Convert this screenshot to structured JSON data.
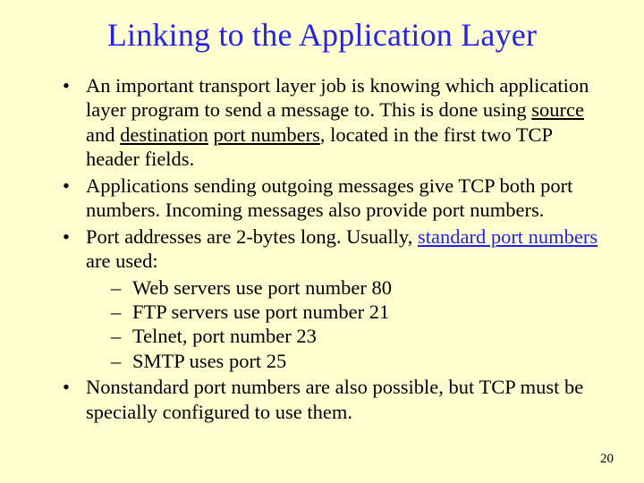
{
  "title": "Linking to the Application Layer",
  "pagenum": "20",
  "b1": {
    "pre": "An important transport layer job is knowing which application layer program to send a message to. This is done using ",
    "u1": "source",
    "mid1": " and ",
    "u2": "destination",
    "mid2": " ",
    "u3": "port numbers",
    "post": ", located in the first two TCP header fields."
  },
  "b2": "Applications sending outgoing messages give TCP both port numbers. Incoming messages also provide port numbers.",
  "b3": {
    "pre": "Port addresses are 2-bytes long. Usually, ",
    "lnk": "standard port numbers ",
    "post": "are used:"
  },
  "b3s1": "Web servers use port number 80",
  "b3s2": "FTP servers use port number 21",
  "b3s3": "Telnet, port number 23",
  "b3s4": "SMTP uses port 25",
  "b4": "Nonstandard port numbers are also possible, but TCP must be specially configured to use them."
}
